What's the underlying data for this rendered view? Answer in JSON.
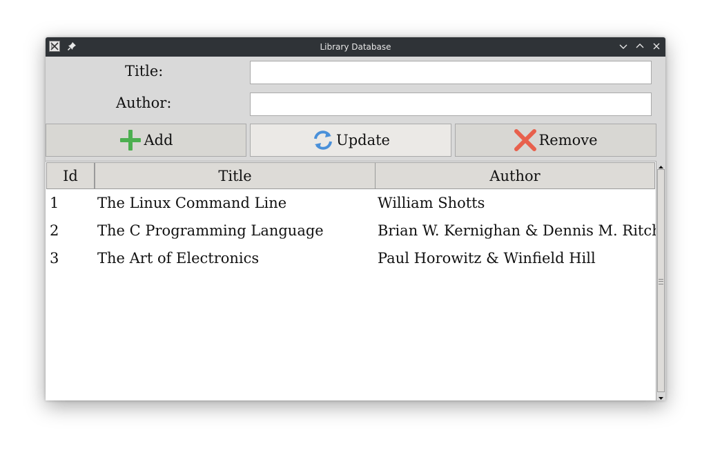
{
  "window": {
    "title": "Library Database"
  },
  "form": {
    "title_label": "Title:",
    "title_value": "",
    "author_label": "Author:",
    "author_value": ""
  },
  "buttons": {
    "add_label": "Add",
    "update_label": "Update",
    "remove_label": "Remove"
  },
  "table": {
    "columns": [
      "Id",
      "Title",
      "Author"
    ],
    "rows": [
      [
        "1",
        "The Linux Command Line",
        "William Shotts"
      ],
      [
        "2",
        "The C Programming Language",
        "Brian W. Kernighan & Dennis M. Ritch"
      ],
      [
        "3",
        "The Art of Electronics",
        "Paul Horowitz & Winfield Hill"
      ]
    ]
  },
  "icons": {
    "add": "plus-icon",
    "update": "refresh-icon",
    "remove": "x-icon"
  },
  "colors": {
    "add_icon": "#4caf50",
    "update_icon": "#4a90d9",
    "remove_icon": "#e8604c",
    "titlebar": "#2f3337"
  }
}
